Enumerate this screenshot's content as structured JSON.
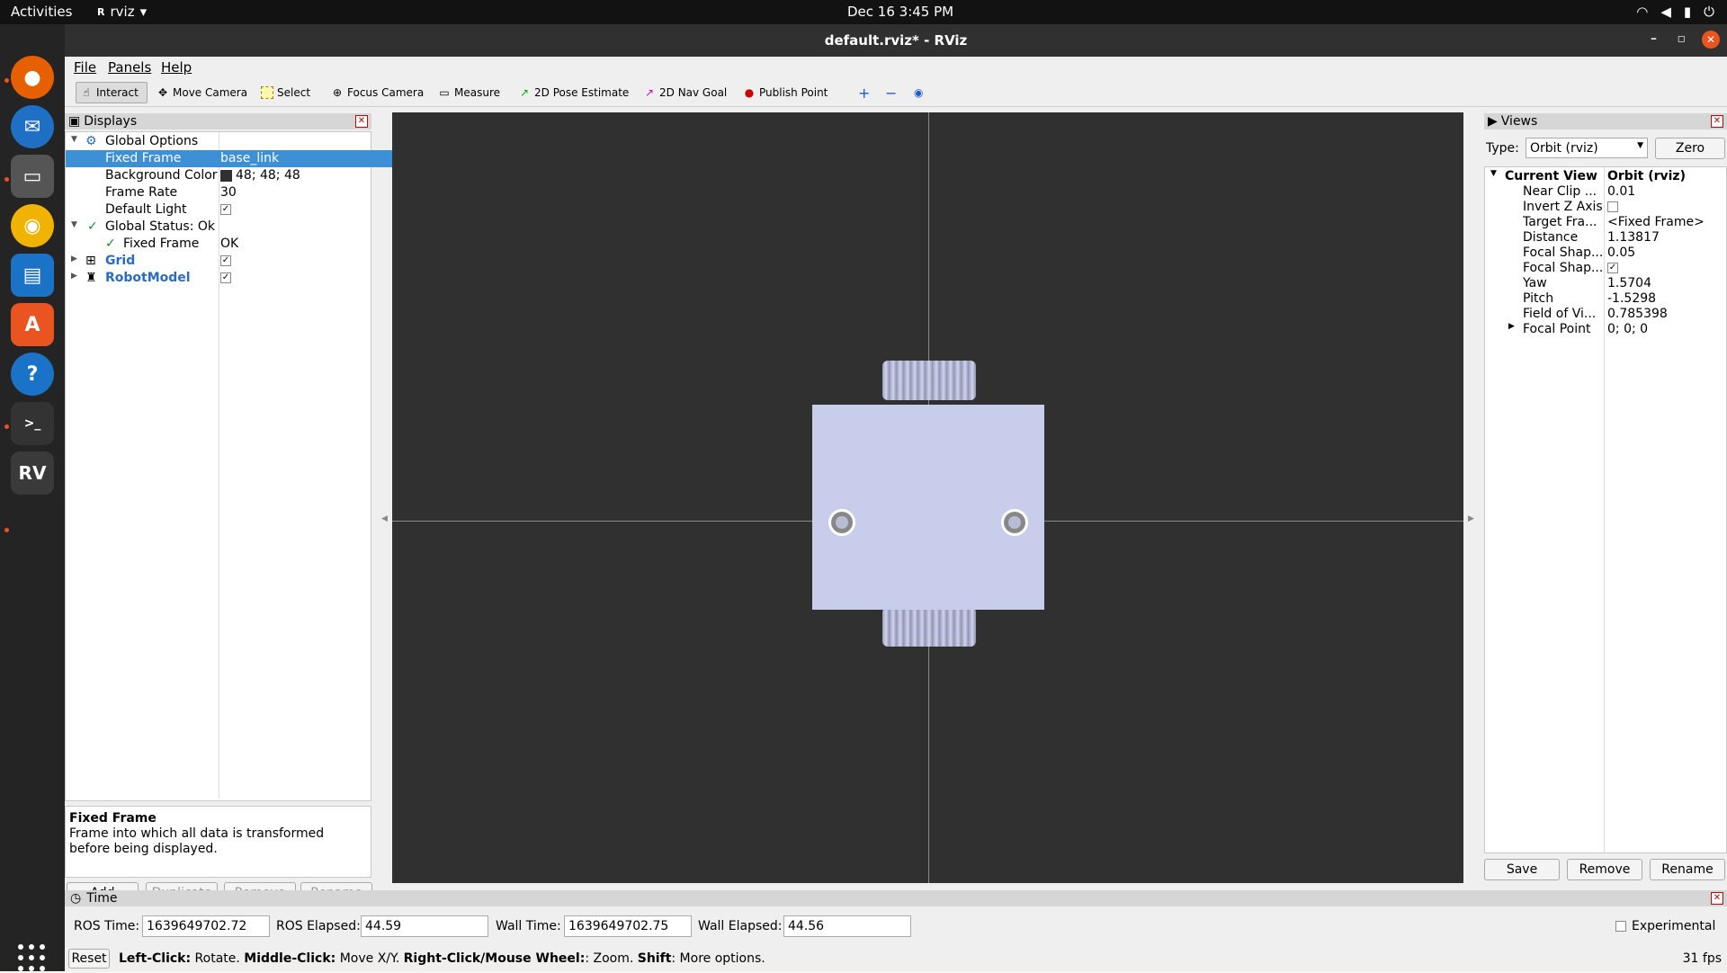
{
  "topbar": {
    "activities": "Activities",
    "app_name": "rviz",
    "clock": "Dec 16  3:45 PM"
  },
  "window": {
    "title": "default.rviz* - RViz"
  },
  "menu": {
    "file": "File",
    "panels": "Panels",
    "help": "Help"
  },
  "toolbar": {
    "interact": "Interact",
    "move_camera": "Move Camera",
    "select": "Select",
    "focus_camera": "Focus Camera",
    "measure": "Measure",
    "pose_estimate": "2D Pose Estimate",
    "nav_goal": "2D Nav Goal",
    "publish_point": "Publish Point"
  },
  "displays": {
    "title": "Displays",
    "global_options": "Global Options",
    "fixed_frame_key": "Fixed Frame",
    "fixed_frame_val": "base_link",
    "bg_color_key": "Background Color",
    "bg_color_val": "48; 48; 48",
    "frame_rate_key": "Frame Rate",
    "frame_rate_val": "30",
    "default_light_key": "Default Light",
    "global_status": "Global Status: Ok",
    "status_fixed_frame_key": "Fixed Frame",
    "status_fixed_frame_val": "OK",
    "grid": "Grid",
    "robot_model": "RobotModel",
    "desc_title": "Fixed Frame",
    "desc_text": "Frame into which all data is transformed before being displayed.",
    "btn_add": "Add",
    "btn_duplicate": "Duplicate",
    "btn_remove": "Remove",
    "btn_rename": "Rename"
  },
  "views": {
    "title": "Views",
    "type_label": "Type:",
    "type_value": "Orbit (rviz)",
    "zero": "Zero",
    "current_view": "Current View",
    "current_view_val": "Orbit (rviz)",
    "rows": [
      {
        "k": "Near Clip ...",
        "v": "0.01"
      },
      {
        "k": "Invert Z Axis",
        "v": ""
      },
      {
        "k": "Target Fra...",
        "v": "<Fixed Frame>"
      },
      {
        "k": "Distance",
        "v": "1.13817"
      },
      {
        "k": "Focal Shap...",
        "v": "0.05"
      },
      {
        "k": "Focal Shap...",
        "v": ""
      },
      {
        "k": "Yaw",
        "v": "1.5704"
      },
      {
        "k": "Pitch",
        "v": "-1.5298"
      },
      {
        "k": "Field of Vi...",
        "v": "0.785398"
      },
      {
        "k": "Focal Point",
        "v": "0; 0; 0"
      }
    ],
    "btn_save": "Save",
    "btn_remove": "Remove",
    "btn_rename": "Rename"
  },
  "time": {
    "title": "Time",
    "ros_time_label": "ROS Time:",
    "ros_time": "1639649702.72",
    "ros_elapsed_label": "ROS Elapsed:",
    "ros_elapsed": "44.59",
    "wall_time_label": "Wall Time:",
    "wall_time": "1639649702.75",
    "wall_elapsed_label": "Wall Elapsed:",
    "wall_elapsed": "44.56",
    "experimental": "Experimental"
  },
  "status": {
    "reset": "Reset",
    "lc": "Left-Click:",
    "lc_t": " Rotate. ",
    "mc": "Middle-Click:",
    "mc_t": " Move X/Y. ",
    "rc": "Right-Click/Mouse Wheel:",
    "rc_t": ": Zoom. ",
    "sh": "Shift",
    "sh_t": ": More options.",
    "fps": "31 fps"
  }
}
